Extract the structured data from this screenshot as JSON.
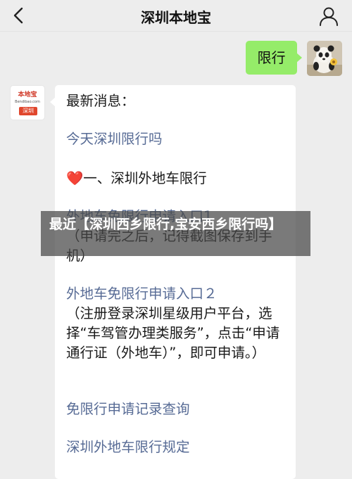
{
  "header": {
    "title": "深圳本地宝",
    "back_icon": "chevron-left-icon",
    "profile_icon": "person-icon"
  },
  "outgoing": {
    "text": "限行",
    "bubble_color": "#95ec69"
  },
  "account": {
    "logo_name": "本地宝",
    "logo_url": "Bendibao.com",
    "logo_city": "深圳"
  },
  "incoming": {
    "heading": "最新消息：",
    "link_today": "今天深圳限行吗",
    "section_heart": "❤️",
    "section_title": "一、深圳外地车限行",
    "item1_link": "外地车免限行申请入口1",
    "item1_note": "（申请完之后，记得截图保存到手机）",
    "item2_link": "外地车免限行申请入口２",
    "item2_note": "（注册登录深圳星级用户平台，选择“车驾管办理类服务”，点击“申请通行证（外地车）”，即可申请。）",
    "link_records": "免限行申请记录查询",
    "link_rules": "深圳外地车限行规定",
    "link_color": "#576b95"
  },
  "banner": {
    "text": "最近【深圳西乡限行,宝安西乡限行吗】"
  }
}
